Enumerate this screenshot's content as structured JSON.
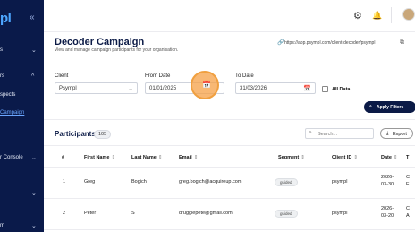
{
  "sidebar": {
    "logo": "pl",
    "collapse_icon": "«",
    "items": [
      {
        "label": "s",
        "caret": "⌄"
      },
      {
        "label": "rs",
        "caret": "^"
      },
      {
        "label": "spects",
        "caret": ""
      },
      {
        "label": "Campaign",
        "caret": ""
      },
      {
        "label": "r Console",
        "caret": "⌄"
      },
      {
        "label": "",
        "caret": "⌄"
      },
      {
        "label": "m",
        "caret": "⌄"
      }
    ]
  },
  "topbar": {
    "settings_icon": "⚙",
    "bell_icon": "🔔"
  },
  "header": {
    "title": "Decoder Campaign",
    "subtitle": "View and manage campaign participants for your organisation.",
    "url": "https://app.psympl.com/client-decoder/psympl"
  },
  "filters": {
    "client_label": "Client",
    "client_value": "Psympl",
    "from_label": "From Date",
    "from_value": "01/01/2025",
    "to_label": "To Date",
    "to_value": "31/03/2026",
    "all_data_label": "All Data",
    "apply_label": "Apply Filters"
  },
  "participants": {
    "title": "Participants",
    "count": "105",
    "search_placeholder": "Search...",
    "export_label": "Export",
    "columns": [
      "#",
      "First Name",
      "Last Name",
      "Email",
      "Segment",
      "Client ID",
      "Date",
      "T"
    ],
    "rows": [
      {
        "n": "1",
        "first": "Greg",
        "last": "Bogich",
        "email": "greg.bogich@acquireup.com",
        "segment": "guided",
        "client": "psympl",
        "date1": "2026-",
        "date2": "03-30",
        "t1": "C",
        "t2": "F"
      },
      {
        "n": "2",
        "first": "Peter",
        "last": "S",
        "email": "druggiepete@gmail.com",
        "segment": "guided",
        "client": "psympl",
        "date1": "2026-",
        "date2": "03-20",
        "t1": "C",
        "t2": "A"
      }
    ]
  }
}
